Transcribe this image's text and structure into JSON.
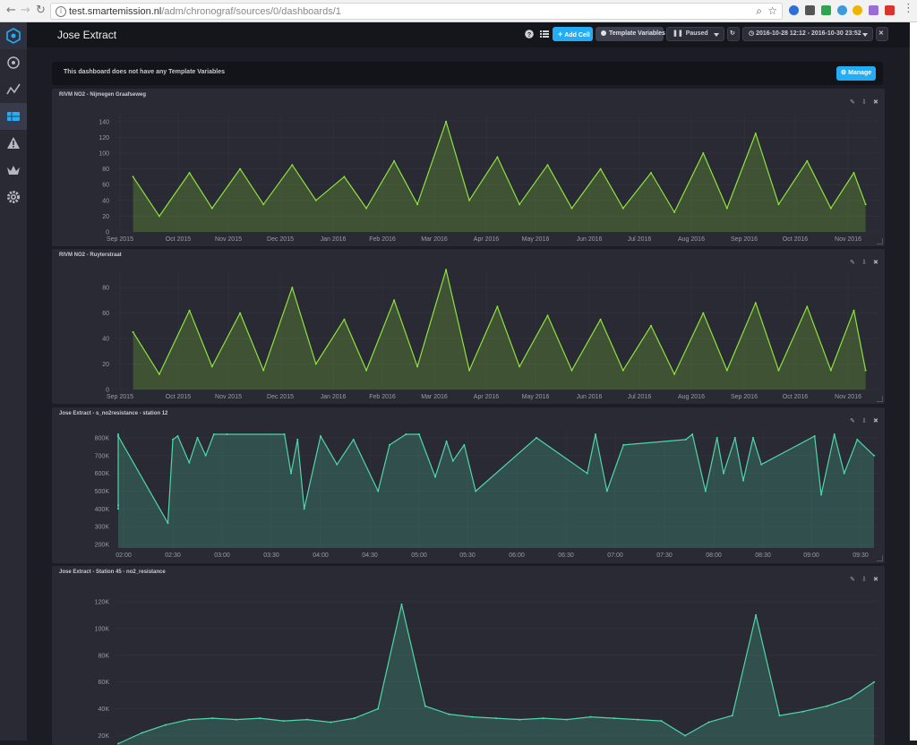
{
  "browser": {
    "url_host": "test.smartemission.nl",
    "url_path": "/adm/chronograf/sources/0/dashboards/1"
  },
  "app": {
    "dashboard_title": "Jose Extract",
    "buttons": {
      "add_cell": "Add Cell",
      "template_variables": "Template Variables",
      "refresh": "Paused",
      "time_range": "2016-10-28 12:12 - 2016-10-30 23:52"
    },
    "banner": {
      "message": "This dashboard does not have any Template Variables",
      "manage": "Manage"
    },
    "sidebar_icons": [
      "chronograf-logo-icon",
      "host-icon",
      "graph-icon",
      "dashboard-icon",
      "alert-icon",
      "crown-icon",
      "gear-icon"
    ]
  },
  "colors": {
    "accent_blue": "#22adf6",
    "series_green": "#8ee33c",
    "series_teal": "#4ed8a8"
  },
  "cells": [
    {
      "title": "RIVM NO2 - Nijmegen Graafseweg"
    },
    {
      "title": "RIVM NO2 - Ruyterstraat"
    },
    {
      "title": "Jose Extract - s_no2resistance - station 12"
    },
    {
      "title": "Jose Extract - Station 45 - no2_resistance"
    }
  ],
  "chart_data": [
    {
      "type": "area",
      "title": "RIVM NO2 - Nijmegen Graafseweg",
      "x_ticks": [
        "Sep 2015",
        "Oct 2015",
        "Nov 2015",
        "Dec 2015",
        "Jan 2016",
        "Feb 2016",
        "Mar 2016",
        "Apr 2016",
        "May 2016",
        "Jun 2016",
        "Jul 2016",
        "Aug 2016",
        "Sep 2016",
        "Oct 2016",
        "Nov 2016"
      ],
      "y_ticks": [
        "0",
        "20",
        "40",
        "60",
        "80",
        "100",
        "120",
        "140"
      ],
      "ylim": [
        0,
        150
      ],
      "grid": true,
      "color": "#8ee33c",
      "x": [
        "Sep 2015",
        "Sep 2015",
        "Oct 2015",
        "Oct 2015",
        "Nov 2015",
        "Nov 2015",
        "Dec 2015",
        "Dec 2015",
        "Jan 2016",
        "Jan 2016",
        "Feb 2016",
        "Feb 2016",
        "Mar 2016",
        "Mar 2016",
        "Apr 2016",
        "Apr 2016",
        "May 2016",
        "May 2016",
        "Jun 2016",
        "Jun 2016",
        "Jul 2016",
        "Jul 2016",
        "Aug 2016",
        "Aug 2016",
        "Sep 2016",
        "Sep 2016",
        "Oct 2016",
        "Oct 2016",
        "Nov 2016",
        "Nov 2016"
      ],
      "values": [
        70,
        20,
        75,
        30,
        80,
        35,
        85,
        40,
        70,
        30,
        90,
        35,
        140,
        40,
        95,
        35,
        85,
        30,
        80,
        30,
        75,
        25,
        100,
        30,
        125,
        35,
        90,
        30,
        75,
        35
      ]
    },
    {
      "type": "area",
      "title": "RIVM NO2 - Ruyterstraat",
      "x_ticks": [
        "Sep 2015",
        "Oct 2015",
        "Nov 2015",
        "Dec 2015",
        "Jan 2016",
        "Feb 2016",
        "Mar 2016",
        "Apr 2016",
        "May 2016",
        "Jun 2016",
        "Jul 2016",
        "Aug 2016",
        "Sep 2016",
        "Oct 2016",
        "Nov 2016"
      ],
      "y_ticks": [
        "0",
        "20",
        "40",
        "60",
        "80"
      ],
      "ylim": [
        0,
        92
      ],
      "grid": true,
      "color": "#8ee33c",
      "x": [
        "Sep 2015",
        "Sep 2015",
        "Oct 2015",
        "Oct 2015",
        "Nov 2015",
        "Nov 2015",
        "Dec 2015",
        "Dec 2015",
        "Jan 2016",
        "Jan 2016",
        "Feb 2016",
        "Feb 2016",
        "Mar 2016",
        "Mar 2016",
        "Apr 2016",
        "Apr 2016",
        "May 2016",
        "May 2016",
        "Jun 2016",
        "Jun 2016",
        "Jul 2016",
        "Jul 2016",
        "Aug 2016",
        "Aug 2016",
        "Sep 2016",
        "Sep 2016",
        "Oct 2016",
        "Oct 2016",
        "Nov 2016",
        "Nov 2016"
      ],
      "values": [
        45,
        12,
        62,
        18,
        60,
        15,
        80,
        20,
        55,
        15,
        70,
        18,
        94,
        15,
        65,
        18,
        58,
        15,
        55,
        15,
        50,
        12,
        60,
        15,
        68,
        15,
        65,
        15,
        62,
        15
      ]
    },
    {
      "type": "area",
      "title": "Jose Extract - s_no2resistance - station 12",
      "x_ticks": [
        "02:00",
        "02:30",
        "03:00",
        "03:30",
        "04:00",
        "04:30",
        "05:00",
        "05:30",
        "06:00",
        "06:30",
        "07:00",
        "07:30",
        "08:00",
        "08:30",
        "09:00",
        "09:30"
      ],
      "y_ticks": [
        "200K",
        "300K",
        "400K",
        "500K",
        "600K",
        "700K",
        "800K"
      ],
      "ylim": [
        180000,
        840000
      ],
      "grid": true,
      "color": "#4ed8a8",
      "x": [
        "01:40",
        "01:43",
        "01:46",
        "01:50",
        "01:55",
        "02:27",
        "02:30",
        "02:33",
        "02:40",
        "02:45",
        "02:50",
        "02:55",
        "03:03",
        "03:38",
        "03:42",
        "03:46",
        "03:50",
        "04:00",
        "04:10",
        "04:20",
        "04:35",
        "04:42",
        "04:52",
        "05:00",
        "05:10",
        "05:17",
        "05:21",
        "05:28",
        "05:35",
        "06:12",
        "06:43",
        "06:48",
        "06:55",
        "07:05",
        "07:43",
        "07:47",
        "07:55",
        "08:02",
        "08:06",
        "08:13",
        "08:18",
        "08:24",
        "08:29",
        "09:02",
        "09:06",
        "09:14",
        "09:20",
        "09:28",
        "09:40"
      ],
      "values": [
        820000,
        400000,
        810000,
        420000,
        810000,
        320000,
        790000,
        810000,
        660000,
        800000,
        700000,
        820000,
        820000,
        820000,
        600000,
        790000,
        400000,
        810000,
        650000,
        790000,
        500000,
        760000,
        820000,
        820000,
        580000,
        780000,
        670000,
        760000,
        500000,
        800000,
        600000,
        820000,
        500000,
        760000,
        790000,
        820000,
        500000,
        800000,
        600000,
        800000,
        560000,
        800000,
        650000,
        810000,
        480000,
        820000,
        600000,
        790000,
        700000
      ]
    },
    {
      "type": "area",
      "title": "Jose Extract - Station 45 - no2_resistance",
      "y_ticks": [
        "20K",
        "40K",
        "60K",
        "80K",
        "100K",
        "120K"
      ],
      "ylim": [
        13000,
        128000
      ],
      "grid": true,
      "color": "#4ed8a8",
      "values": [
        14000,
        22000,
        28000,
        32000,
        33000,
        32000,
        33000,
        31000,
        32000,
        30000,
        33000,
        40000,
        118000,
        42000,
        36000,
        34000,
        33000,
        32000,
        33000,
        32000,
        34000,
        33000,
        32000,
        31000,
        20000,
        30000,
        35000,
        110000,
        35000,
        38000,
        42000,
        48000,
        60000
      ]
    }
  ]
}
